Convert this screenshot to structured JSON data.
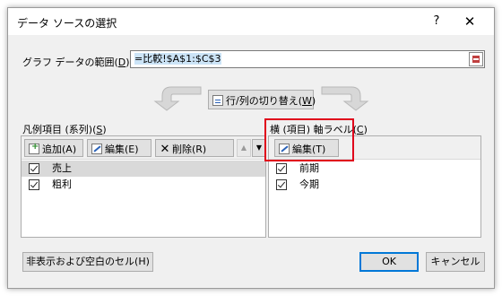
{
  "dialog": {
    "title": "データ ソースの選択",
    "help": "?",
    "close": "✕"
  },
  "range": {
    "label": "グラフ データの範囲(",
    "label_key": "D",
    "label_suffix": "):",
    "value": "=比較!$A$1:$C$3"
  },
  "switch_button": {
    "label": "行/列の切り替え(",
    "key": "W",
    "suffix": ")"
  },
  "legend_panel": {
    "label": "凡例項目 (系列)(",
    "key": "S",
    "suffix": ")",
    "add": "追加(A)",
    "edit": "編集(E)",
    "delete": "削除(R)",
    "up": "▲",
    "down": "▼",
    "items": [
      {
        "label": "売上",
        "checked": true,
        "selected": true
      },
      {
        "label": "粗利",
        "checked": true,
        "selected": false
      }
    ]
  },
  "axis_panel": {
    "label": "横 (項目) 軸ラベル(",
    "key": "C",
    "suffix": ")",
    "edit": "編集(T)",
    "items": [
      {
        "label": "前期",
        "checked": true
      },
      {
        "label": "今期",
        "checked": true
      }
    ]
  },
  "buttons": {
    "hidden_cells": "非表示および空白のセル(H)",
    "ok": "OK",
    "cancel": "キャンセル"
  },
  "colors": {
    "highlight": "#e0001b",
    "ok_border": "#0078d7"
  }
}
